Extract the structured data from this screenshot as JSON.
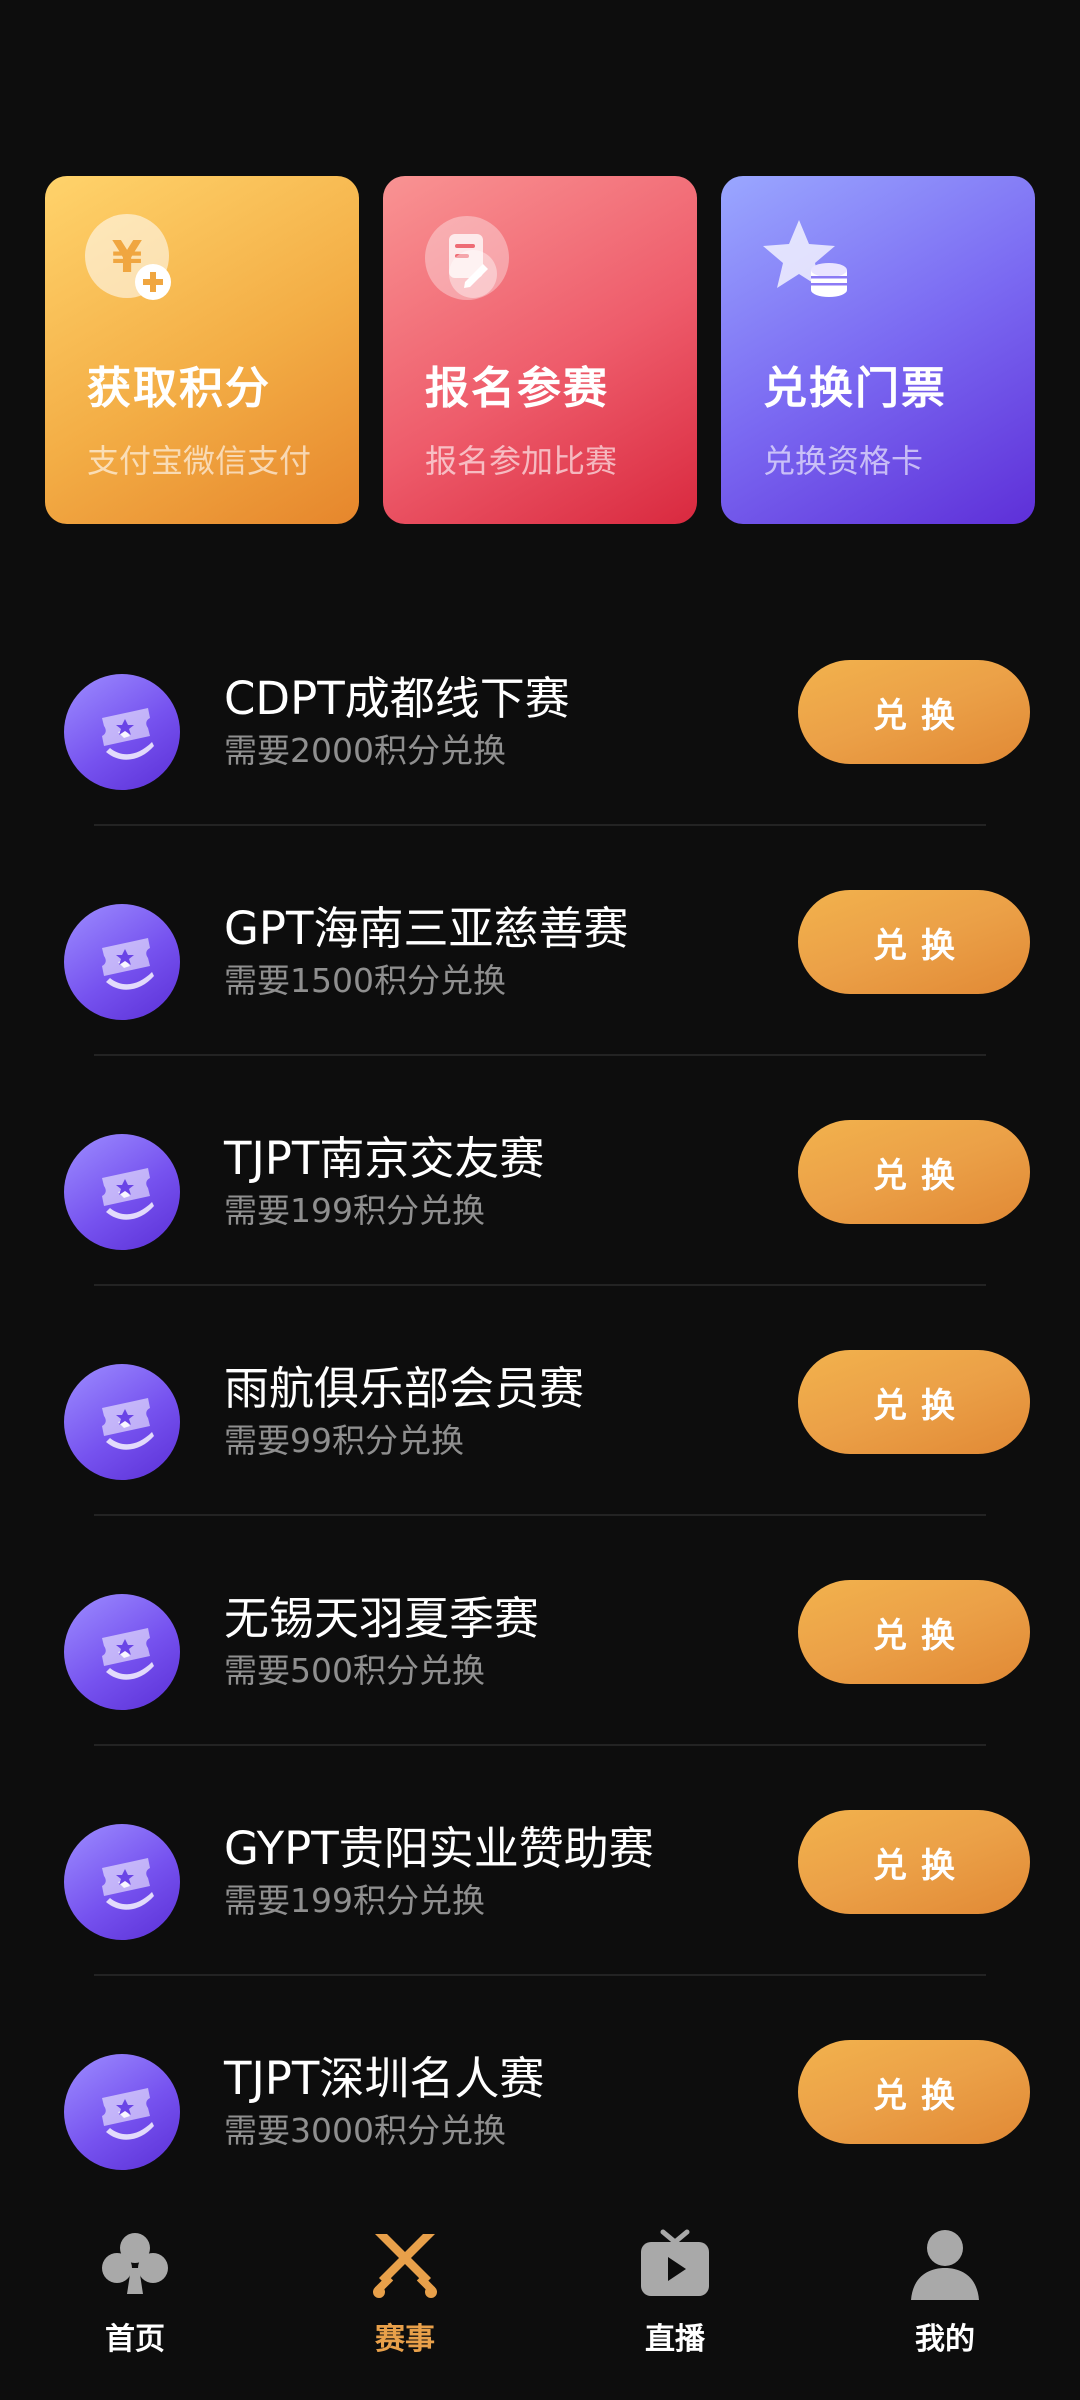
{
  "top_cards": [
    {
      "title": "获取积分",
      "subtitle": "支付宝微信支付",
      "icon": "yen-plus-icon"
    },
    {
      "title": "报名参赛",
      "subtitle": "报名参加比赛",
      "icon": "document-edit-icon"
    },
    {
      "title": "兑换门票",
      "subtitle": "兑换资格卡",
      "icon": "star-coins-icon"
    }
  ],
  "tournaments": [
    {
      "name": "CDPT成都线下赛",
      "cost": "需要2000积分兑换",
      "button": "兑换"
    },
    {
      "name": "GPT海南三亚慈善赛",
      "cost": "需要1500积分兑换",
      "button": "兑换"
    },
    {
      "name": "TJPT南京交友赛",
      "cost": "需要199积分兑换",
      "button": "兑换"
    },
    {
      "name": "雨航俱乐部会员赛",
      "cost": "需要99积分兑换",
      "button": "兑换"
    },
    {
      "name": "无锡天羽夏季赛",
      "cost": "需要500积分兑换",
      "button": "兑换"
    },
    {
      "name": "GYPT贵阳实业赞助赛",
      "cost": "需要199积分兑换",
      "button": "兑换"
    },
    {
      "name": "TJPT深圳名人赛",
      "cost": "需要3000积分兑换",
      "button": "兑换"
    }
  ],
  "nav": [
    {
      "label": "首页",
      "icon": "club-suit-icon",
      "active": false
    },
    {
      "label": "赛事",
      "icon": "crossed-swords-icon",
      "active": true
    },
    {
      "label": "直播",
      "icon": "tv-play-icon",
      "active": false
    },
    {
      "label": "我的",
      "icon": "user-icon",
      "active": false
    }
  ],
  "colors": {
    "background": "#0d0d0d",
    "accent": "#e8a04a",
    "button_gradient": [
      "#f2b24d",
      "#e18935"
    ],
    "muted_text": "#8f8f8f"
  }
}
